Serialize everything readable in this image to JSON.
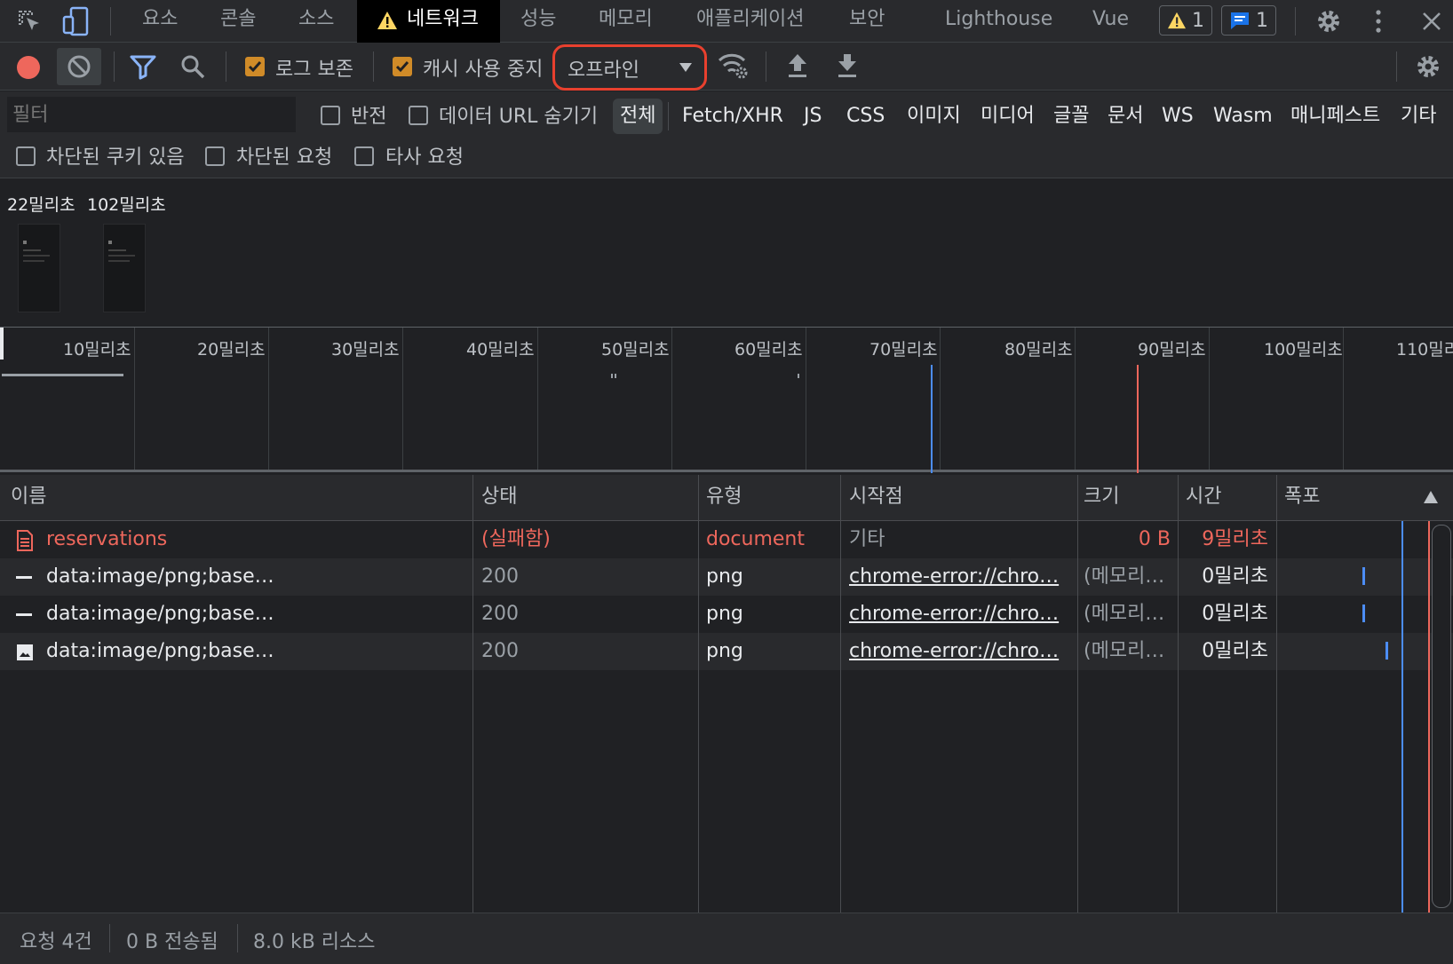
{
  "tabs": {
    "elements": "요소",
    "console": "콘솔",
    "sources": "소스",
    "network": "네트워크",
    "performance": "성능",
    "memory": "메모리",
    "application": "애플리케이션",
    "security": "보안",
    "lighthouse": "Lighthouse",
    "vue": "Vue",
    "warning_count": "1",
    "message_count": "1"
  },
  "toolbar": {
    "preserve_log": "로그 보존",
    "disable_cache": "캐시 사용 중지",
    "throttle_value": "오프라인"
  },
  "filter": {
    "placeholder": "필터",
    "invert": "반전",
    "hide_data_urls": "데이터 URL 숨기기",
    "types": [
      "전체",
      "Fetch/XHR",
      "JS",
      "CSS",
      "이미지",
      "미디어",
      "글꼴",
      "문서",
      "WS",
      "Wasm",
      "매니페스트",
      "기타"
    ],
    "blocked_cookies": "차단된 쿠키 있음",
    "blocked_requests": "차단된 요청",
    "third_party": "타사 요청"
  },
  "overview": {
    "screenshots": [
      "22밀리초",
      "102밀리초"
    ]
  },
  "timeline": {
    "ticks": [
      "10밀리초",
      "20밀리초",
      "30밀리초",
      "40밀리초",
      "50밀리초",
      "60밀리초",
      "70밀리초",
      "80밀리초",
      "90밀리초",
      "100밀리초",
      "110밀리초"
    ]
  },
  "table": {
    "headers": {
      "name": "이름",
      "status": "상태",
      "type": "유형",
      "initiator": "시작점",
      "size": "크기",
      "time": "시간",
      "waterfall": "폭포"
    },
    "rows": [
      {
        "name": "reservations",
        "status": "(실패함)",
        "type": "document",
        "initiator": "기타",
        "size": "0 B",
        "time": "9밀리초"
      },
      {
        "name": "data:image/png;base…",
        "status": "200",
        "type": "png",
        "initiator": "chrome-error://chro…",
        "size": "(메모리…",
        "time": "0밀리초"
      },
      {
        "name": "data:image/png;base…",
        "status": "200",
        "type": "png",
        "initiator": "chrome-error://chro…",
        "size": "(메모리…",
        "time": "0밀리초"
      },
      {
        "name": "data:image/png;base…",
        "status": "200",
        "type": "png",
        "initiator": "chrome-error://chro…",
        "size": "(메모리…",
        "time": "0밀리초"
      }
    ]
  },
  "status": {
    "requests": "요청 4건",
    "transferred": "0 B 전송됨",
    "resources": "8.0 kB 리소스"
  },
  "colors": {
    "error": "#ee675c",
    "checkbox": "#d08b28",
    "record": "#ee675c",
    "dom_content_loaded": "#4c8df6",
    "load": "#ee675c",
    "highlight_outline": "#e8402e"
  }
}
